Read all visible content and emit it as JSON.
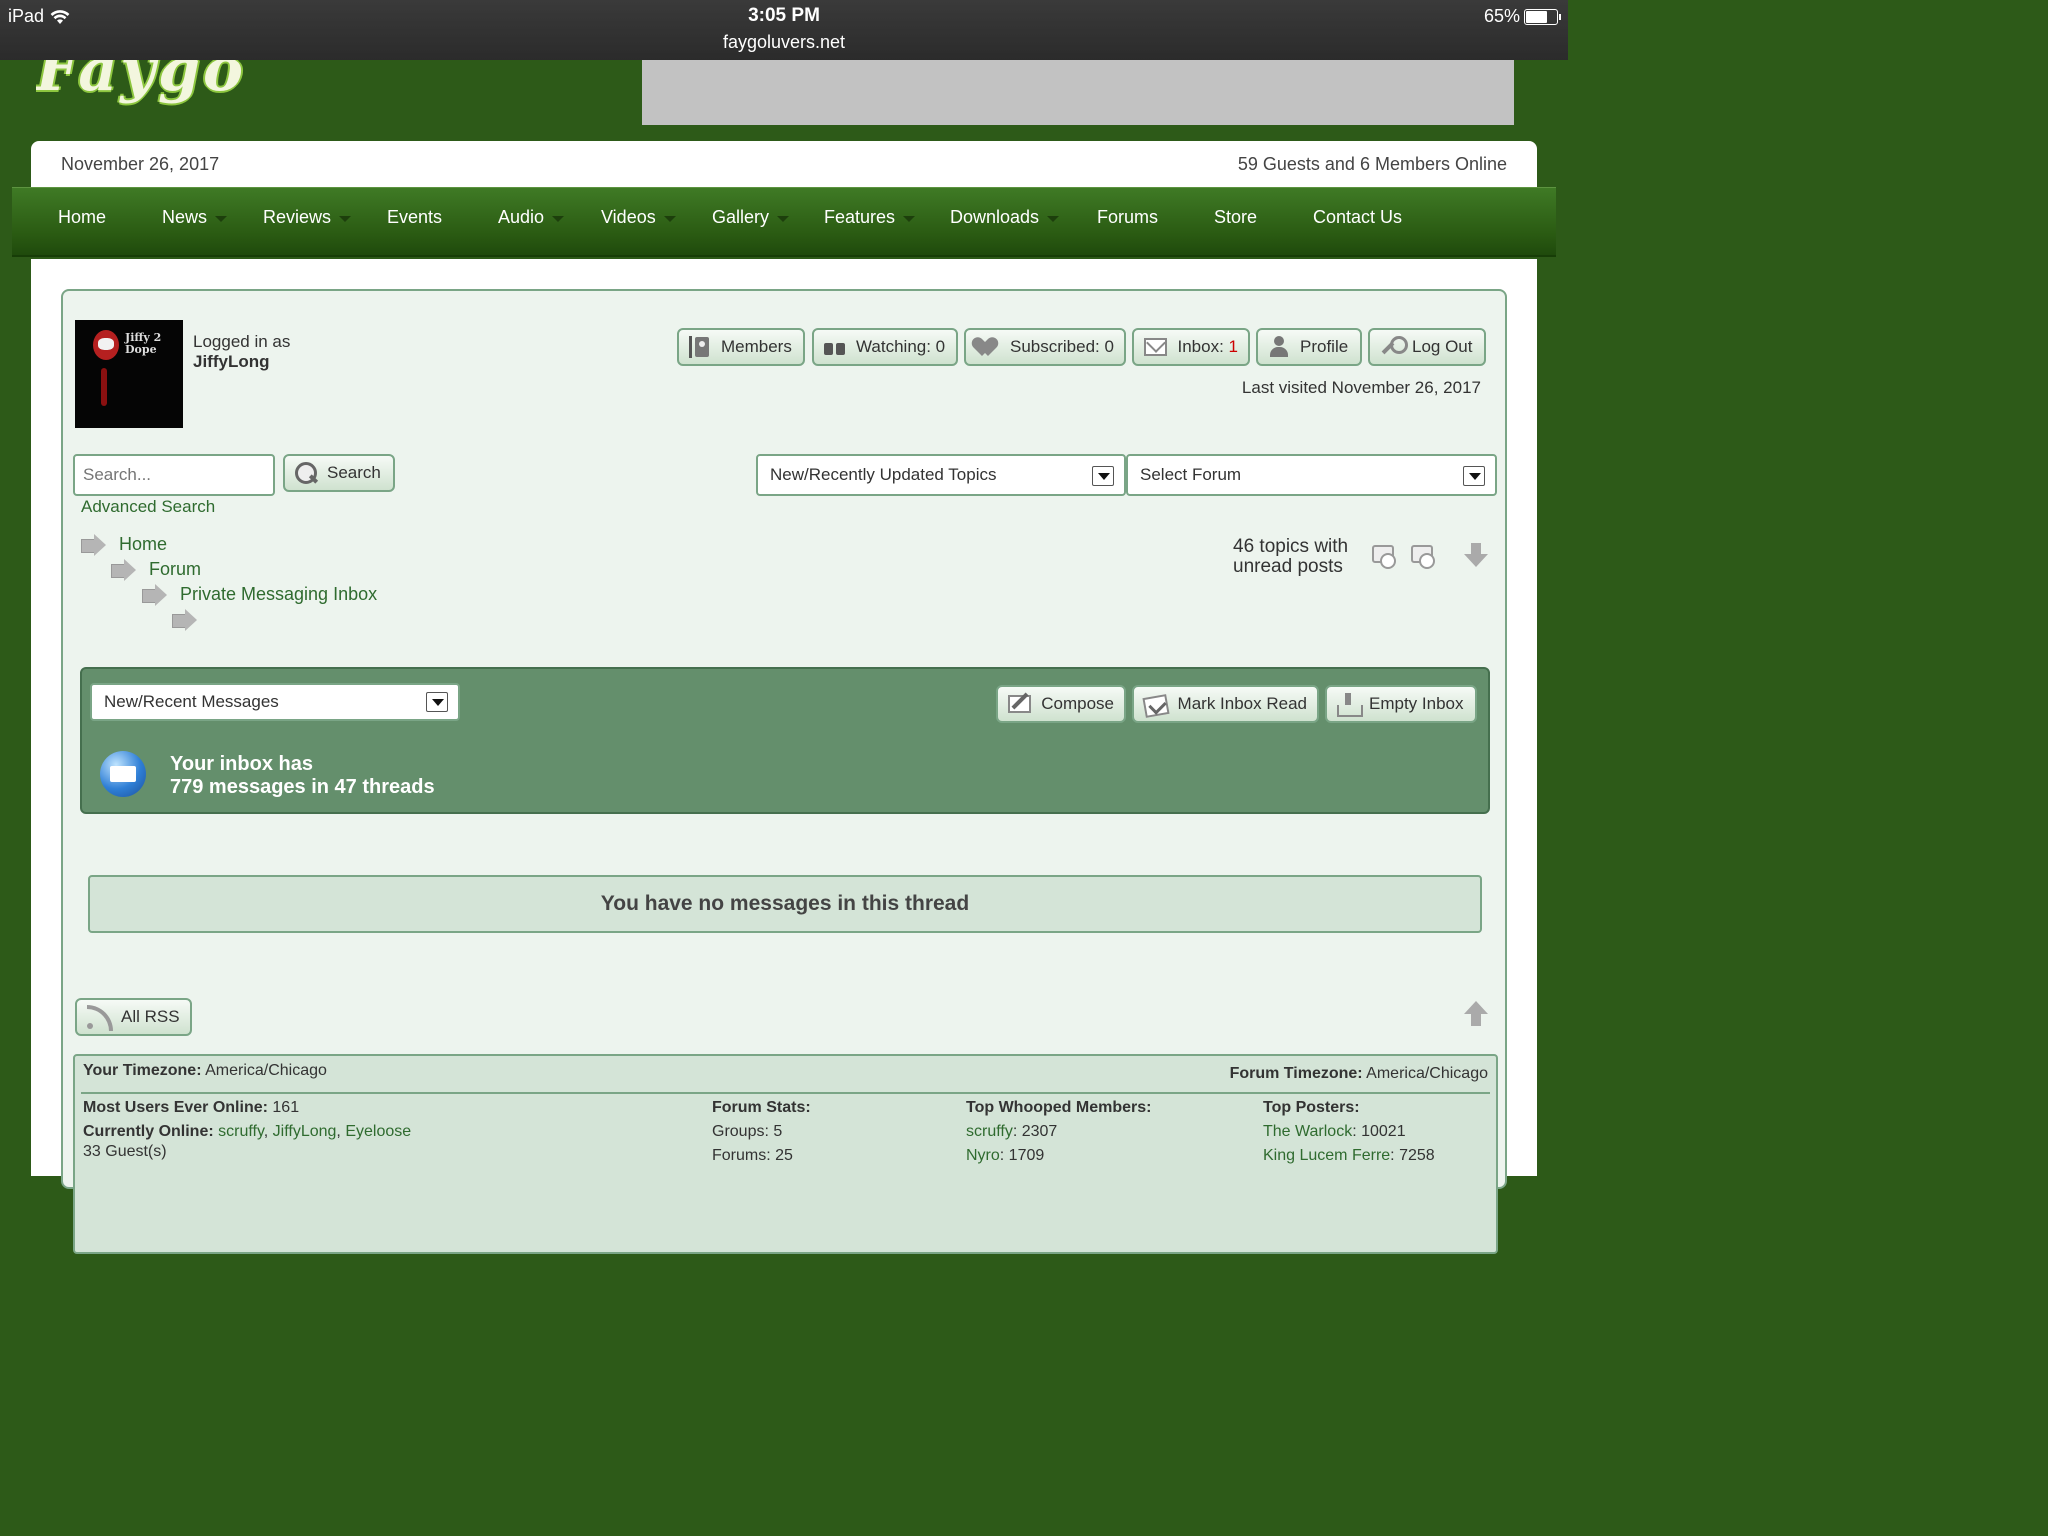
{
  "status_bar": {
    "device": "iPad",
    "time": "3:05 PM",
    "url": "faygoluvers.net",
    "battery": "65%"
  },
  "header": {
    "logo_text": "Faygo"
  },
  "info_bar": {
    "date": "November 26, 2017",
    "online": "59 Guests and 6 Members Online"
  },
  "nav": {
    "items": [
      {
        "label": "Home",
        "has_caret": false
      },
      {
        "label": "News",
        "has_caret": true
      },
      {
        "label": "Reviews",
        "has_caret": true
      },
      {
        "label": "Events",
        "has_caret": false
      },
      {
        "label": "Audio",
        "has_caret": true
      },
      {
        "label": "Videos",
        "has_caret": true
      },
      {
        "label": "Gallery",
        "has_caret": true
      },
      {
        "label": "Features",
        "has_caret": true
      },
      {
        "label": "Downloads",
        "has_caret": true
      },
      {
        "label": "Forums",
        "has_caret": false
      },
      {
        "label": "Store",
        "has_caret": false
      },
      {
        "label": "Contact Us",
        "has_caret": false
      }
    ]
  },
  "user": {
    "avatar_text": "Jiffy 2 Dope",
    "logged_in_label": "Logged in as",
    "username": "JiffyLong",
    "last_visited": "Last visited November 26, 2017"
  },
  "toolbar": {
    "members": "Members",
    "watching": "Watching: 0",
    "subscribed": "Subscribed: 0",
    "inbox_label": "Inbox:",
    "inbox_count": "1",
    "profile": "Profile",
    "logout": "Log Out"
  },
  "search": {
    "placeholder": "Search...",
    "button": "Search",
    "advanced": "Advanced Search"
  },
  "selects": {
    "topics": "New/Recently Updated Topics",
    "forum": "Select Forum",
    "messages": "New/Recent Messages"
  },
  "breadcrumb": [
    "Home",
    "Forum",
    "Private Messaging Inbox"
  ],
  "unread": {
    "line1": "46 topics with",
    "line2": "unread posts"
  },
  "pm": {
    "compose": "Compose",
    "mark_read": "Mark Inbox Read",
    "empty": "Empty Inbox",
    "inbox_line1": "Your inbox has",
    "inbox_line2": "779 messages in 47 threads"
  },
  "no_messages": "You have no messages in this thread",
  "rss": "All RSS",
  "stats": {
    "your_tz_label": "Your Timezone:",
    "your_tz": "America/Chicago",
    "forum_tz_label": "Forum Timezone:",
    "forum_tz": "America/Chicago",
    "most_online_label": "Most Users Ever Online:",
    "most_online": "161",
    "currently_online_label": "Currently Online:",
    "currently_online": [
      "scruffy",
      "JiffyLong",
      "Eyeloose"
    ],
    "guests": "33 Guest(s)",
    "forum_stats_label": "Forum Stats:",
    "groups": "Groups: 5",
    "forums": "Forums: 25",
    "top_whooped_label": "Top Whooped Members:",
    "top_whooped": [
      {
        "name": "scruffy",
        "value": ": 2307"
      },
      {
        "name": "Nyro",
        "value": ": 1709"
      }
    ],
    "top_posters_label": "Top Posters:",
    "top_posters": [
      {
        "name": "The Warlock",
        "value": ": 10021"
      },
      {
        "name": "King Lucem Ferre",
        "value": ": 7258"
      }
    ]
  }
}
